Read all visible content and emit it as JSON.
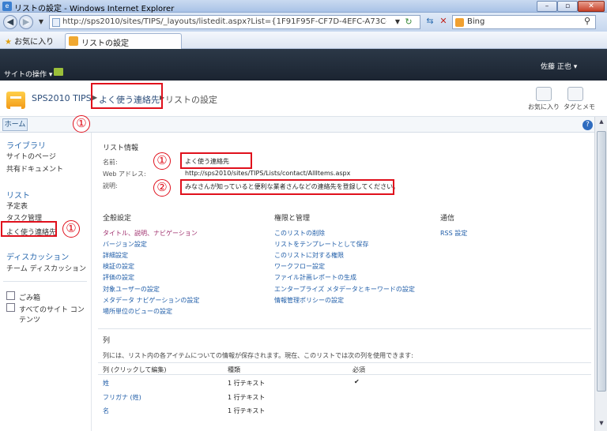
{
  "window": {
    "title": "リストの設定 - Windows Internet Explorer"
  },
  "address": {
    "url": "http://sps2010/sites/TIPS/_layouts/listedit.aspx?List={1F91F95F-CF7D-4EFC-A73C-320A3D6BC1D",
    "search_label": "Bing"
  },
  "favorites": {
    "label": "お気に入り",
    "tab_title": "リストの設定"
  },
  "sp": {
    "site_actions": "サイトの操作",
    "user": "佐藤 正也"
  },
  "breadcrumb": {
    "site": "SPS2010 TIPS",
    "list": "よく使う連絡先",
    "page": "リストの設定"
  },
  "toolbar": {
    "favorite": "お気に入り",
    "tags": "タグとメモ"
  },
  "tabs": {
    "home": "ホーム"
  },
  "leftnav": {
    "libraries": "ライブラリ",
    "site_pages": "サイトのページ",
    "shared_docs": "共有ドキュメント",
    "lists": "リスト",
    "calendar": "予定表",
    "tasks": "タスク管理",
    "contacts": "よく使う連絡先",
    "discussions": "ディスカッション",
    "team_discussion": "チーム ディスカッション",
    "recycle": "ごみ箱",
    "all_content": "すべてのサイト コンテンツ"
  },
  "listinfo": {
    "header": "リスト情報",
    "name_label": "名前:",
    "name_value": "よく使う連絡先",
    "web_label": "Web アドレス:",
    "web_value": "http://sps2010/sites/TIPS/Lists/contact/AllItems.aspx",
    "desc_label": "説明:",
    "desc_value": "みなさんが知っていると便利な業者さんなどの連絡先を登録してください。"
  },
  "general": {
    "header": "全般設定",
    "links": [
      "タイトル、説明、ナビゲーション",
      "バージョン設定",
      "詳細設定",
      "検証の設定",
      "評価の設定",
      "対象ユーザーの設定",
      "メタデータ ナビゲーションの設定",
      "場所単位のビューの設定"
    ]
  },
  "permissions": {
    "header": "権限と管理",
    "links": [
      "このリストの削除",
      "リストをテンプレートとして保存",
      "このリストに対する権限",
      "ワークフロー設定",
      "ファイル計画レポートの生成",
      "エンタープライズ メタデータとキーワードの設定",
      "情報管理ポリシーの設定"
    ]
  },
  "communications": {
    "header": "通信",
    "links": [
      "RSS 設定"
    ]
  },
  "columns": {
    "header": "列",
    "description": "列には、リスト内の各アイテムについての情報が保存されます。現在、このリストでは次の列を使用できます:",
    "headers": [
      "列 (クリックして編集)",
      "種類",
      "必須"
    ],
    "rows": [
      {
        "name": "姓",
        "type": "1 行テキスト",
        "required": "✔"
      },
      {
        "name": "フリガナ (姓)",
        "type": "1 行テキスト",
        "required": ""
      },
      {
        "name": "名",
        "type": "1 行テキスト",
        "required": ""
      }
    ]
  },
  "annotations": {
    "n1": "①",
    "n2": "②"
  }
}
